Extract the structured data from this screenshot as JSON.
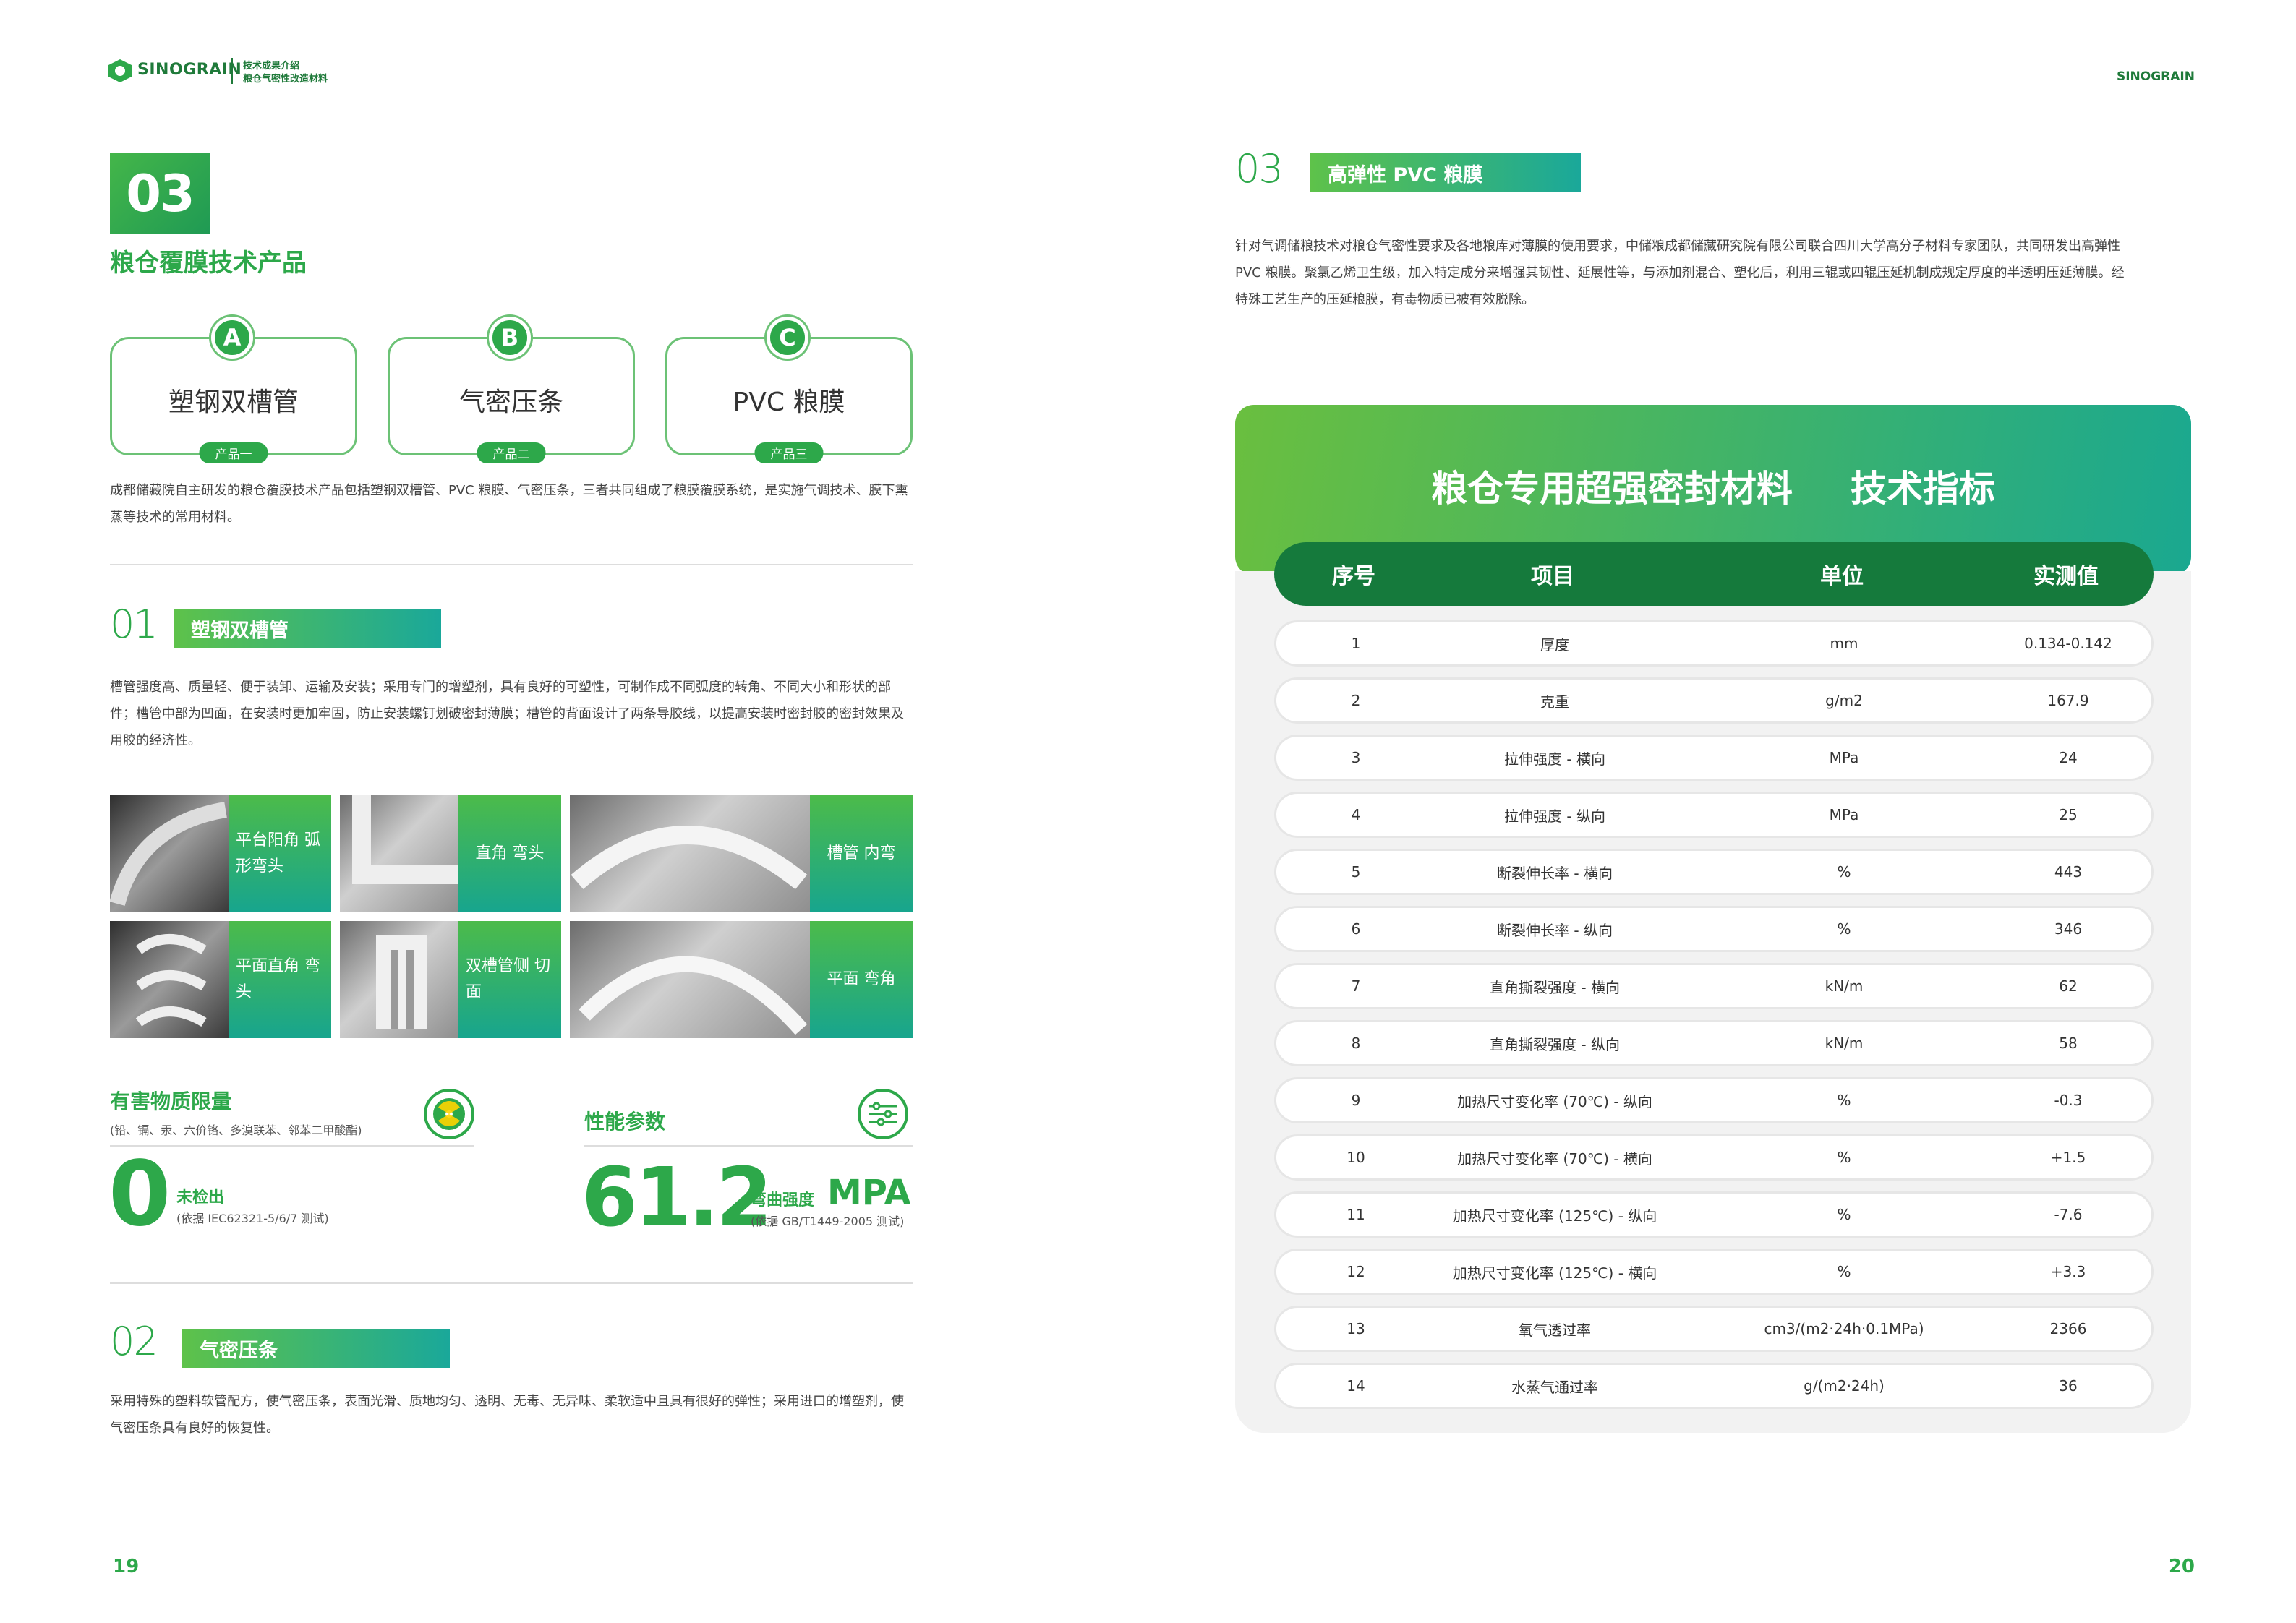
{
  "header": {
    "logo": "SINOGRAIN",
    "sub_line1": "技术成果介绍",
    "sub_line2": "粮仓气密性改造材料",
    "right_logo": "SINOGRAIN"
  },
  "left": {
    "section_num": "03",
    "section_title": "粮仓覆膜技术产品",
    "products": [
      {
        "badge": "A",
        "name": "塑钢双槽管",
        "tag": "产品一"
      },
      {
        "badge": "B",
        "name": "气密压条",
        "tag": "产品二"
      },
      {
        "badge": "C",
        "name": "PVC 粮膜",
        "tag": "产品三"
      }
    ],
    "intro": "成都储藏院自主研发的粮仓覆膜技术产品包括塑钢双槽管、PVC 粮膜、气密压条，三者共同组成了粮膜覆膜系统，是实施气调技术、膜下熏蒸等技术的常用材料。",
    "s1": {
      "num": "01",
      "title": "塑钢双槽管",
      "text": "槽管强度高、质量轻、便于装卸、运输及安装；采用专门的增塑剂，具有良好的可塑性，可制作成不同弧度的转角、不同大小和形状的部件；槽管中部为凹面，在安装时更加牢固，防止安装螺钉划破密封薄膜；槽管的背面设计了两条导胶线，以提高安装时密封胶的密封效果及用胶的经济性。",
      "photos": [
        {
          "label": "平台阳角 弧形弯头"
        },
        {
          "label": "直角 弯头"
        },
        {
          "label": "槽管 内弯"
        },
        {
          "label": "平面直角 弯头"
        },
        {
          "label": "双槽管侧 切面"
        },
        {
          "label": "平面 弯角"
        }
      ]
    },
    "harm": {
      "title": "有害物质限量",
      "subtitle": "(铅、镉、汞、六价铬、多溴联苯、邻苯二甲酸酯)",
      "value": "0",
      "value_label": "未检出",
      "value_note": "(依据 IEC62321-5/6/7 测试)",
      "icon": "radiation-icon"
    },
    "perf": {
      "title": "性能参数",
      "value": "61.2",
      "value_label": "弯曲强度",
      "unit": "MPA",
      "value_note": "(依据 GB/T1449-2005 测试)",
      "icon": "sliders-icon"
    },
    "s2": {
      "num": "02",
      "title": "气密压条",
      "text": "采用特殊的塑料软管配方，使气密压条，表面光滑、质地均匀、透明、无毒、无异味、柔软适中且具有很好的弹性；采用进口的增塑剂，使气密压条具有良好的恢复性。"
    },
    "page_num": "19"
  },
  "right": {
    "s3": {
      "num": "03",
      "title": "高弹性 PVC 粮膜",
      "text": "针对气调储粮技术对粮仓气密性要求及各地粮库对薄膜的使用要求，中储粮成都储藏研究院有限公司联合四川大学高分子材料专家团队，共同研发出高弹性 PVC 粮膜。聚氯乙烯卫生级，加入特定成分来增强其韧性、延展性等，与添加剂混合、塑化后，利用三辊或四辊压延机制成规定厚度的半透明压延薄膜。经特殊工艺生产的压延粮膜，有毒物质已被有效脱除。"
    },
    "table_title_a": "粮仓专用超强密封材料",
    "table_title_b": "技术指标",
    "columns": [
      "序号",
      "项目",
      "单位",
      "实测值"
    ],
    "rows": [
      [
        "1",
        "厚度",
        "mm",
        "0.134-0.142"
      ],
      [
        "2",
        "克重",
        "g/m2",
        "167.9"
      ],
      [
        "3",
        "拉伸强度 - 横向",
        "MPa",
        "24"
      ],
      [
        "4",
        "拉伸强度 - 纵向",
        "MPa",
        "25"
      ],
      [
        "5",
        "断裂伸长率 - 横向",
        "%",
        "443"
      ],
      [
        "6",
        "断裂伸长率 - 纵向",
        "%",
        "346"
      ],
      [
        "7",
        "直角撕裂强度 - 横向",
        "kN/m",
        "62"
      ],
      [
        "8",
        "直角撕裂强度 - 纵向",
        "kN/m",
        "58"
      ],
      [
        "9",
        "加热尺寸变化率 (70℃) - 纵向",
        "%",
        "-0.3"
      ],
      [
        "10",
        "加热尺寸变化率 (70℃) - 横向",
        "%",
        "+1.5"
      ],
      [
        "11",
        "加热尺寸变化率 (125℃) - 纵向",
        "%",
        "-7.6"
      ],
      [
        "12",
        "加热尺寸变化率 (125℃) - 横向",
        "%",
        "+3.3"
      ],
      [
        "13",
        "氧气透过率",
        "cm3/(m2·24h·0.1MPa)",
        "2366"
      ],
      [
        "14",
        "水蒸气通过率",
        "g/(m2·24h)",
        "36"
      ]
    ],
    "page_num": "20"
  }
}
